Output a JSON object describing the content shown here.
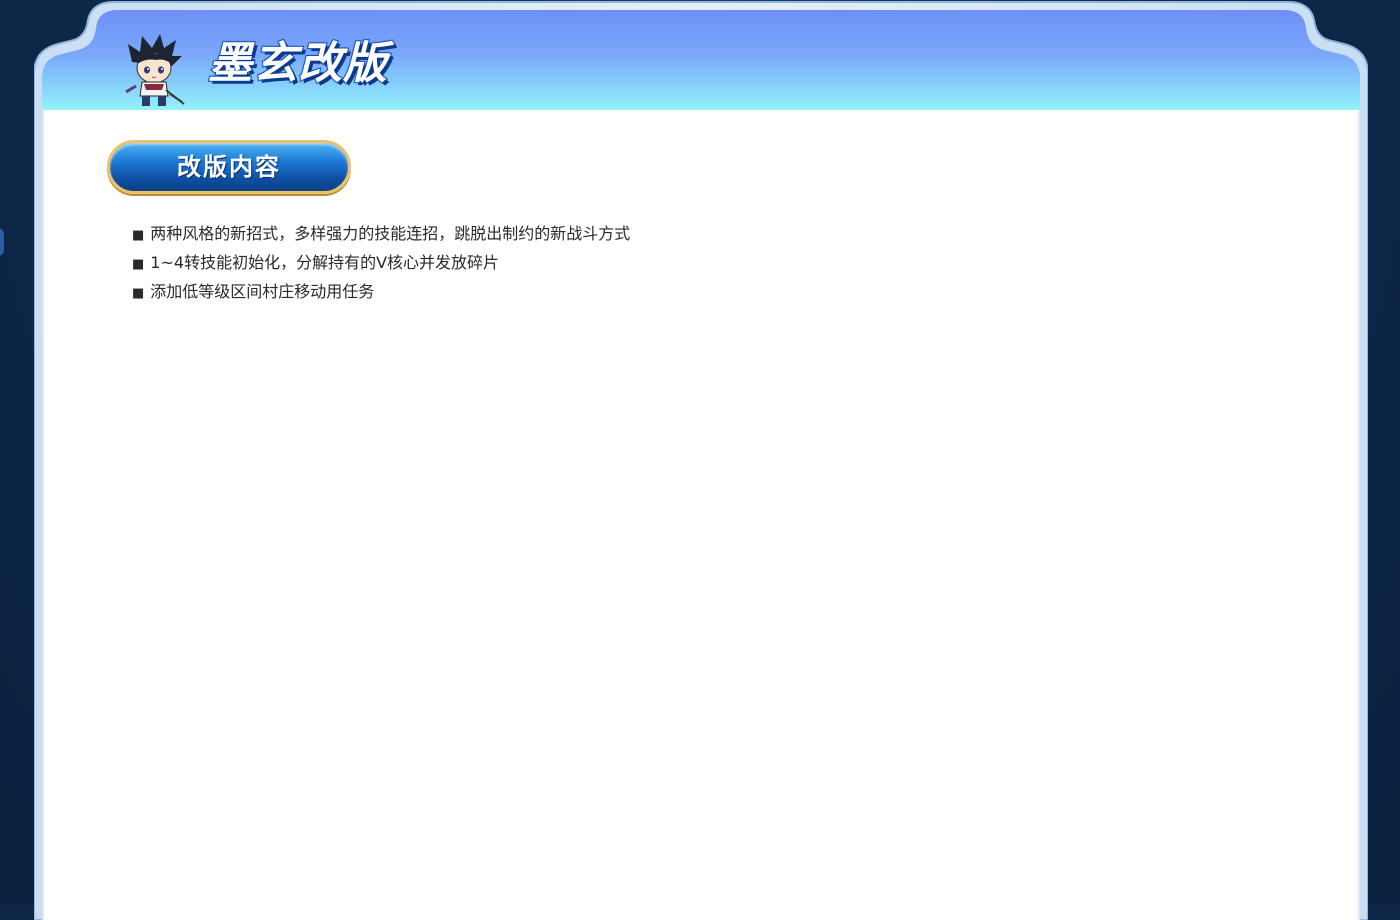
{
  "header": {
    "title": "墨玄改版"
  },
  "section": {
    "tab_label": "改版内容"
  },
  "content": {
    "bullet_symbol": "■",
    "items": [
      "两种风格的新招式，多样强力的技能连招，跳脱出制约的新战斗方式",
      "1~4转技能初始化，分解持有的V核心并发放碎片",
      "添加低等级区间村庄移动用任务"
    ]
  },
  "colors": {
    "page_background": "#0d2547",
    "header_gradient_top": "#6e8ff8",
    "header_gradient_bottom": "#93f2fb",
    "frame_border": "#b8d4ee",
    "tab_border": "#e9c26a",
    "tab_fill": "#1b78d4",
    "title_stroke": "#1d57c4",
    "body_text": "#2a2a2a"
  },
  "icons": {
    "avatar": "chibi-character-avatar"
  }
}
